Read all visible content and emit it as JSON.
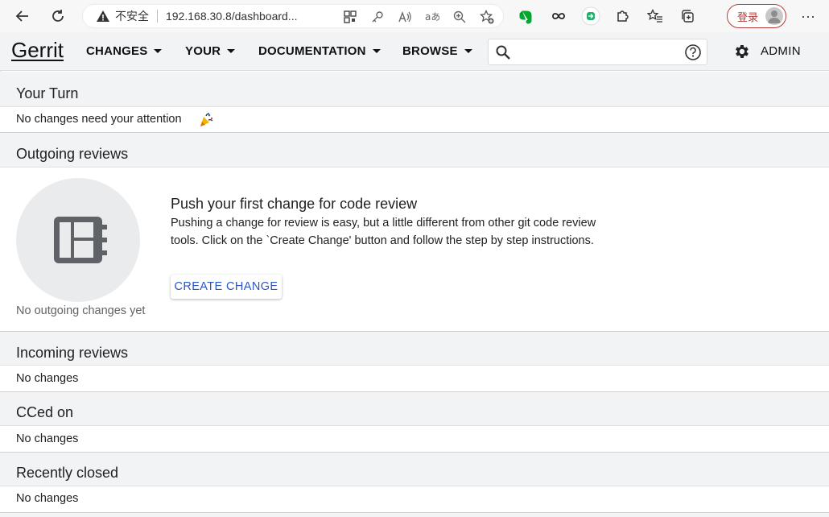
{
  "browser": {
    "insecure_label": "不安全",
    "url": "192.168.30.8/dashboard...",
    "login_label": "登录",
    "more_label": "···"
  },
  "header": {
    "logo": "Gerrit",
    "menus": [
      "CHANGES",
      "YOUR",
      "DOCUMENTATION",
      "BROWSE"
    ],
    "search_placeholder": "",
    "account": "ADMIN"
  },
  "sections": {
    "your_turn": {
      "title": "Your Turn",
      "message": "No changes need your attention"
    },
    "outgoing": {
      "title": "Outgoing reviews",
      "empty_caption": "No outgoing changes yet",
      "push_title": "Push your first change for code review",
      "push_desc": "Pushing a change for review is easy, but a little different from other git code review tools. Click on the `Create Change' button and follow the step by step instructions.",
      "create_button": "CREATE CHANGE"
    },
    "incoming": {
      "title": "Incoming reviews",
      "message": "No changes"
    },
    "cced": {
      "title": "CCed on",
      "message": "No changes"
    },
    "recently_closed": {
      "title": "Recently closed",
      "message": "No changes"
    }
  },
  "colors": {
    "header_bg": "#f1f3f4",
    "link_blue": "#2a56c6",
    "login_red": "#b33a3a"
  }
}
